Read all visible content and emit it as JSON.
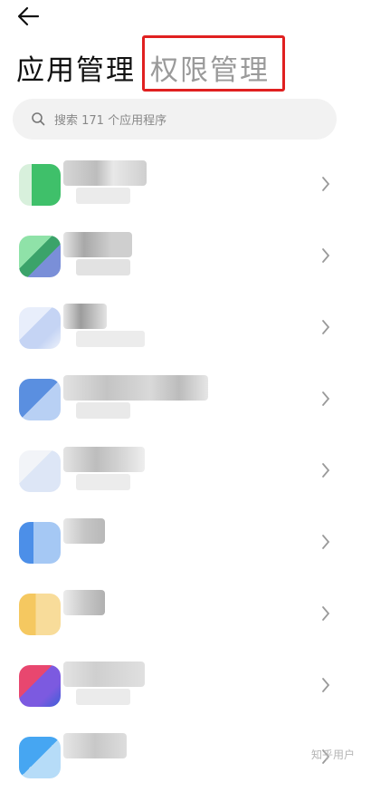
{
  "header": {
    "tab_active": "应用管理",
    "tab_inactive": "权限管理"
  },
  "search": {
    "placeholder": "搜索 171 个应用程序"
  },
  "colors": {
    "highlight": "#e02020",
    "search_bg": "#f2f2f2",
    "inactive_tab": "#9a9a9a"
  },
  "icons": [
    "back-arrow-icon",
    "search-icon",
    "chevron-right-icon"
  ],
  "watermark": "知乎用户"
}
